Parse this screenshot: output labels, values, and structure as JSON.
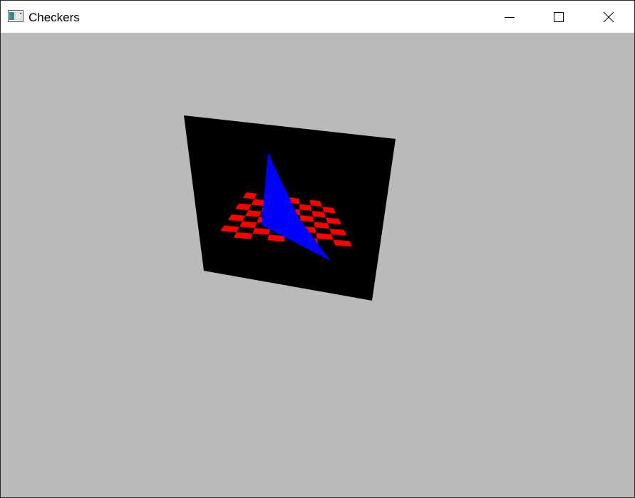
{
  "window": {
    "title": "Checkers",
    "app_icon": "window-app-icon",
    "controls": {
      "minimize_icon": "minimize-icon",
      "maximize_icon": "maximize-icon",
      "close_icon": "close-icon"
    }
  },
  "scene": {
    "background_color": "#bababa",
    "panel_color": "#000000",
    "checker_color": "#ff0000",
    "triangle_color": "#0000ff",
    "checkerboard_size": 8
  }
}
